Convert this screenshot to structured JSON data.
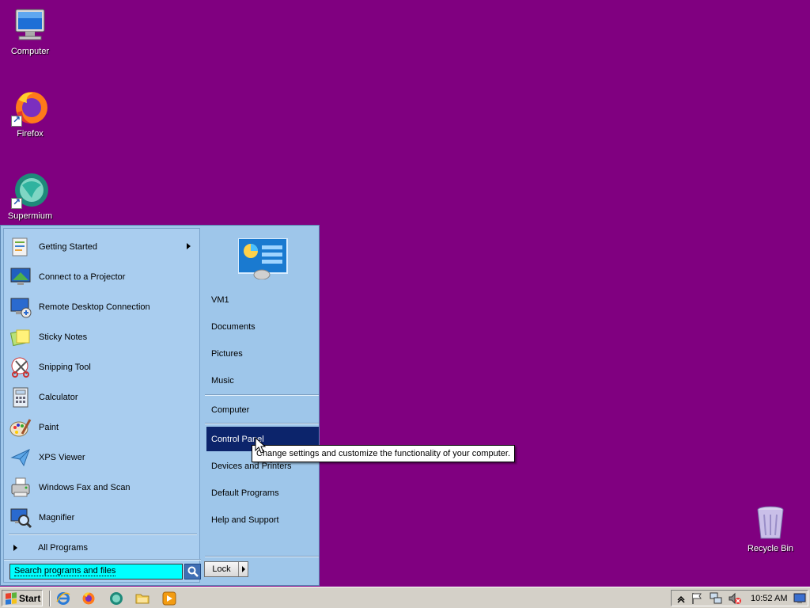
{
  "desktop": {
    "background_color": "#800080",
    "icons": [
      {
        "label": "Computer",
        "icon": "computer-icon"
      },
      {
        "label": "Firefox",
        "icon": "firefox-icon"
      },
      {
        "label": "Supermium",
        "icon": "supermium-icon"
      },
      {
        "label": "Recycle Bin",
        "icon": "recycle-bin-icon"
      }
    ]
  },
  "start_menu": {
    "programs": [
      {
        "label": "Getting Started",
        "icon": "getting-started-icon",
        "has_submenu": true
      },
      {
        "label": "Connect to a Projector",
        "icon": "projector-icon"
      },
      {
        "label": "Remote Desktop Connection",
        "icon": "remote-desktop-icon"
      },
      {
        "label": "Sticky Notes",
        "icon": "sticky-notes-icon"
      },
      {
        "label": "Snipping Tool",
        "icon": "snipping-tool-icon"
      },
      {
        "label": "Calculator",
        "icon": "calculator-icon"
      },
      {
        "label": "Paint",
        "icon": "paint-icon"
      },
      {
        "label": "XPS Viewer",
        "icon": "xps-viewer-icon"
      },
      {
        "label": "Windows Fax and Scan",
        "icon": "fax-scan-icon"
      },
      {
        "label": "Magnifier",
        "icon": "magnifier-icon"
      }
    ],
    "all_programs": "All Programs",
    "search_placeholder": "Search programs and files",
    "places": [
      {
        "label": "VM1"
      },
      {
        "label": "Documents"
      },
      {
        "label": "Pictures"
      },
      {
        "label": "Music"
      },
      {
        "label": "Computer"
      },
      {
        "label": "Control Panel",
        "highlighted": true
      },
      {
        "label": "Devices and Printers"
      },
      {
        "label": "Default Programs"
      },
      {
        "label": "Help and Support"
      }
    ],
    "lock_label": "Lock",
    "tooltip": "Change settings and customize the functionality of your computer."
  },
  "taskbar": {
    "start_label": "Start",
    "quick_launch": [
      "internet-explorer-icon",
      "firefox-icon",
      "supermium-icon",
      "folder-icon",
      "media-player-icon"
    ],
    "tray_icons": [
      "show-hidden-icons-icon",
      "flag-icon",
      "network-icon",
      "volume-muted-icon"
    ],
    "clock": "10:52 AM"
  },
  "colors": {
    "highlight": "#0c246b",
    "search_bg": "#00ffff",
    "menu_bg": "#a9cdef"
  }
}
